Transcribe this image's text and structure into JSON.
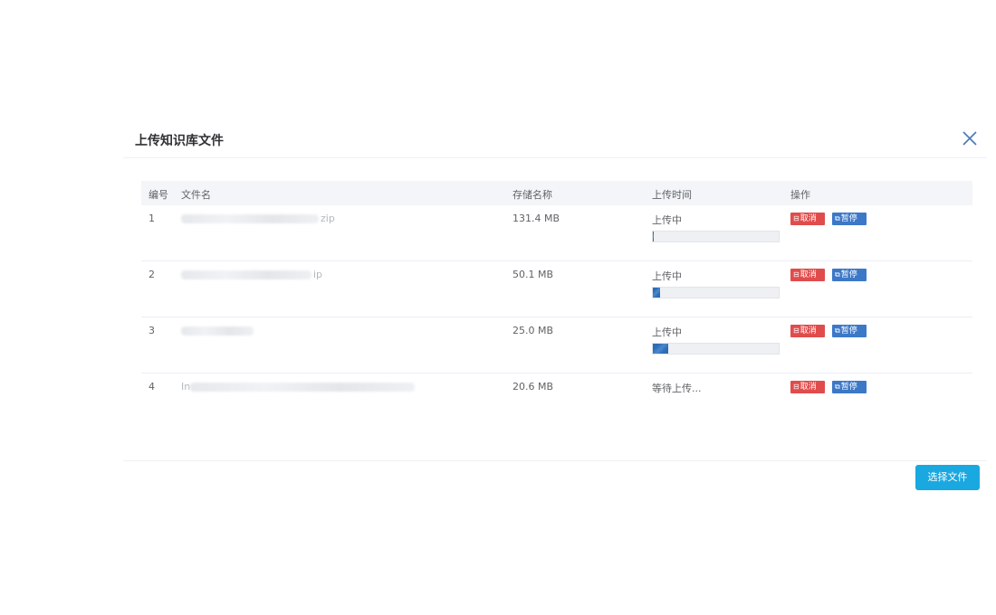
{
  "modal": {
    "title": "上传知识库文件",
    "select_button": "选择文件"
  },
  "table": {
    "headers": {
      "no": "编号",
      "name": "文件名",
      "size": "存储名称",
      "status": "上传时间",
      "ops": "操作"
    },
    "rows": [
      {
        "no": "1",
        "name_ext": "zip",
        "size": "131.4 MB",
        "status": "上传中",
        "progress": 0.01
      },
      {
        "no": "2",
        "name_ext": "ip",
        "size": "50.1 MB",
        "status": "上传中",
        "progress": 0.06
      },
      {
        "no": "3",
        "name_ext": "",
        "size": "25.0 MB",
        "status": "上传中",
        "progress": 0.12
      },
      {
        "no": "4",
        "name_ext": "In",
        "size": "20.6 MB",
        "status": "等待上传...",
        "progress": null
      }
    ],
    "ops": {
      "cancel": "取消",
      "pause": "暂停"
    }
  },
  "colors": {
    "accent": "#1aa8e0",
    "cancel": "#e04c4c",
    "pause": "#3c78c8",
    "progress": "#2d6db5"
  }
}
